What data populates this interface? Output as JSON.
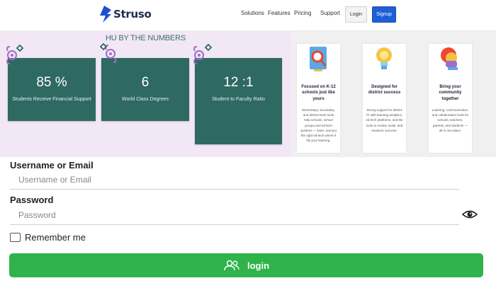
{
  "nav": {
    "brand": "Struso",
    "links": [
      "Solutions",
      "Features",
      "Pricing",
      "Support"
    ],
    "login_label": "Login",
    "signup_label": "Signup",
    "accent": "#1f5fd6"
  },
  "stats": {
    "title": "HU BY THE NUMBERS",
    "background": "#f1e7f5",
    "card_color": "#2e6962",
    "cards": [
      {
        "value": "85 %",
        "label": "Students Receive Financial Support"
      },
      {
        "value": "6",
        "label": "World Class Degrees"
      },
      {
        "value": "12 :1",
        "label": "Student to Faculty Ratio"
      }
    ]
  },
  "features": {
    "cards": [
      {
        "icon": "magnifier-icon",
        "title": "Focused on K-12 schools just like yours",
        "description": "Elementary, secondary, and district-level tools help schools, school groups and ed-tech systems — learn, and put the right ed-tech where it fits your learning."
      },
      {
        "icon": "lightbulb-icon",
        "title": "Designed for district success",
        "description": "Strong support for district IT, with learning analytics, ed-tech platforms, and the tools to review, scale, and measure success."
      },
      {
        "icon": "chat-bubbles-icon",
        "title": "Bring your community together",
        "description": "Learning, communication, and collaboration tools for schools, teachers, parents, and students — all in one place."
      }
    ]
  },
  "login_form": {
    "username_label": "Username or Email",
    "username_placeholder": "Username or Email",
    "password_label": "Password",
    "password_placeholder": "Password",
    "remember_label": "Remember me",
    "submit_label": "login",
    "submit_color": "#2fb34a"
  }
}
